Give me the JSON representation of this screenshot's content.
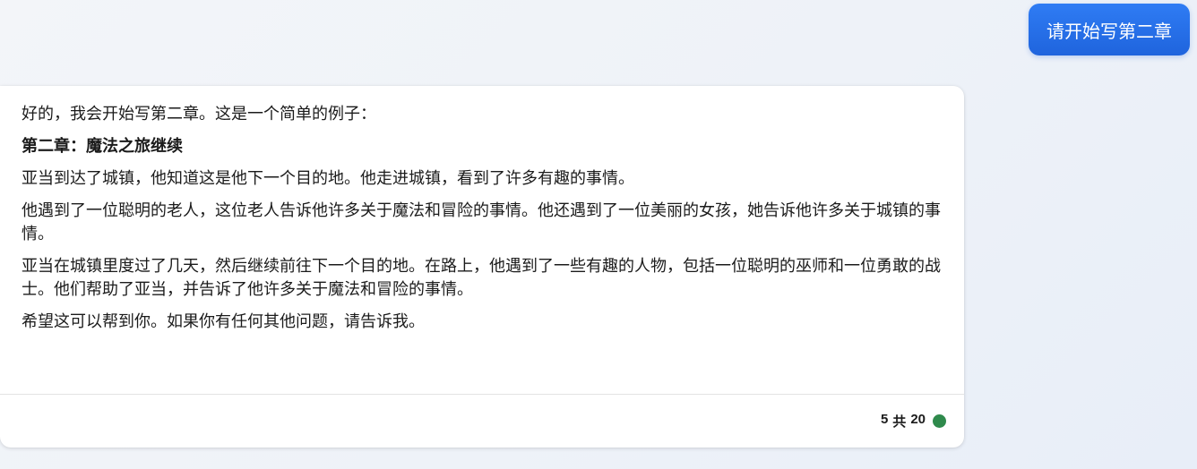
{
  "user_message": {
    "text": "请开始写第二章"
  },
  "bot_message": {
    "paragraphs": [
      "好的，我会开始写第二章。这是一个简单的例子：",
      "第二章：魔法之旅继续",
      "亚当到达了城镇，他知道这是他下一个目的地。他走进城镇，看到了许多有趣的事情。",
      "他遇到了一位聪明的老人，这位老人告诉他许多关于魔法和冒险的事情。他还遇到了一位美丽的女孩，她告诉他许多关于城镇的事情。",
      "亚当在城镇里度过了几天，然后继续前往下一个目的地。在路上，他遇到了一些有趣的人物，包括一位聪明的巫师和一位勇敢的战士。他们帮助了亚当，并告诉了他许多关于魔法和冒险的事情。",
      "希望这可以帮到你。如果你有任何其他问题，请告诉我。"
    ],
    "footer": {
      "current": "5",
      "separator": "共",
      "total": "20",
      "status_color": "#2f8a4c"
    }
  },
  "colors": {
    "user_bubble": "#1f64dd",
    "card_background": "#ffffff"
  }
}
